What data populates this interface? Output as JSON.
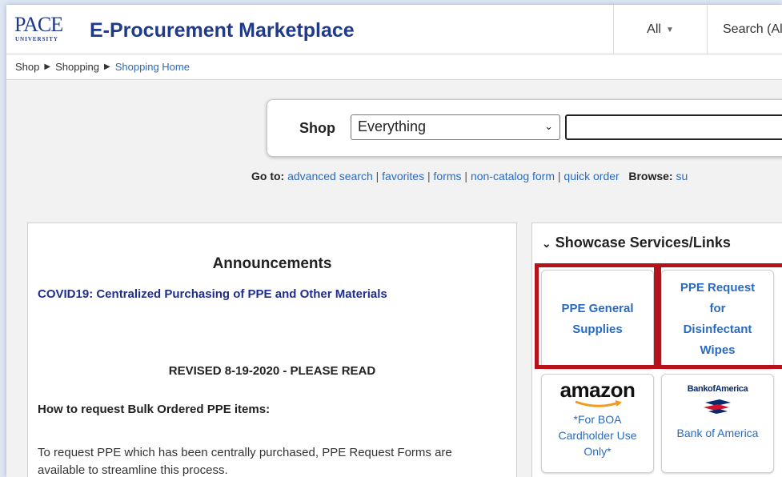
{
  "header": {
    "logo_text": "PACE",
    "logo_subtext": "UNIVERSITY",
    "app_title": "E-Procurement Marketplace",
    "scope_label": "All",
    "search_label": "Search (All"
  },
  "breadcrumb": [
    "Shop",
    "Shopping",
    "Shopping Home"
  ],
  "shop": {
    "label": "Shop",
    "selected": "Everything",
    "query": ""
  },
  "goto": {
    "label": "Go to:",
    "links": [
      "advanced search",
      "favorites",
      "forms",
      "non-catalog form",
      "quick order"
    ],
    "browse_label": "Browse:",
    "browse_first": "su"
  },
  "announcements": {
    "title": "Announcements",
    "covid_link": "COVID19: Centralized Purchasing of PPE and Other Materials",
    "revised": "REVISED 8-19-2020 - PLEASE READ",
    "howto": "How to request Bulk Ordered PPE items:",
    "paragraph": "To request PPE which has been centrally purchased, PPE Request Forms are available to streamline this process."
  },
  "showcase": {
    "title": "Showcase Services/Links",
    "tiles": [
      {
        "label": "PPE General Supplies"
      },
      {
        "label": "PPE Request for Disinfectant Wipes"
      },
      {
        "logo": "amazon",
        "label": "*For BOA Cardholder Use Only*"
      },
      {
        "logo": "BankofAmerica",
        "label": "Bank of America"
      }
    ]
  },
  "colors": {
    "brand_blue": "#1f3a8a",
    "link_blue": "#2a6bc1",
    "highlight_red": "#b5121b"
  }
}
